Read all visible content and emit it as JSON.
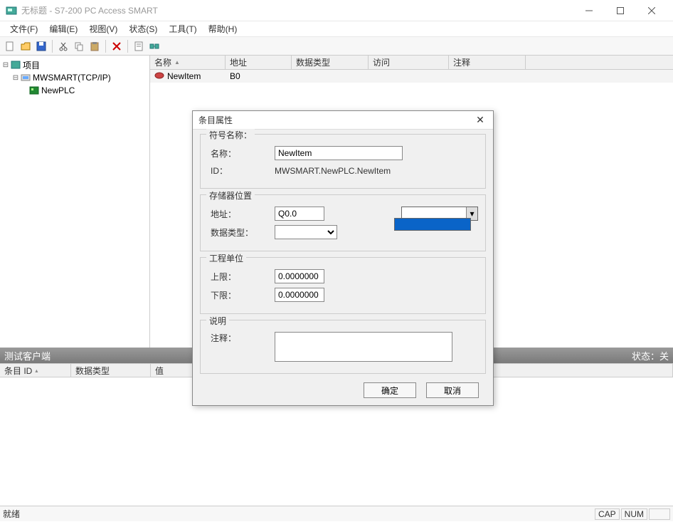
{
  "window": {
    "title": "无标题 - S7-200 PC Access SMART"
  },
  "menu": {
    "file": "文件(F)",
    "edit": "编辑(E)",
    "view": "视图(V)",
    "status": "状态(S)",
    "tools": "工具(T)",
    "help": "帮助(H)"
  },
  "tree": {
    "root": "项目",
    "node1": "MWSMART(TCP/IP)",
    "node2": "NewPLC"
  },
  "grid": {
    "headers": {
      "name": "名称",
      "addr": "地址",
      "type": "数据类型",
      "access": "访问",
      "comment": "注释"
    },
    "row": {
      "name": "NewItem",
      "addr": "B0"
    }
  },
  "testclient": {
    "title": "测试客户端",
    "status_label": "状态：",
    "status_value": "关",
    "cols": {
      "id": "条目 ID",
      "type": "数据类型",
      "value": "值"
    }
  },
  "statusbar": {
    "ready": "就绪",
    "cap": "CAP",
    "num": "NUM"
  },
  "dialog": {
    "title": "条目属性",
    "group_symbol": "符号名称：",
    "label_name": "名称：",
    "value_name": "NewItem",
    "label_id": "ID：",
    "value_id": "MWSMART.NewPLC.NewItem",
    "group_storage": "存储器位置",
    "label_addr": "地址：",
    "value_addr": "Q0.0",
    "label_datatype": "数据类型：",
    "group_units": "工程单位",
    "label_upper": "上限：",
    "value_upper": "0.0000000",
    "label_lower": "下限：",
    "value_lower": "0.0000000",
    "group_desc": "说明",
    "label_comment": "注释：",
    "btn_ok": "确定",
    "btn_cancel": "取消"
  }
}
